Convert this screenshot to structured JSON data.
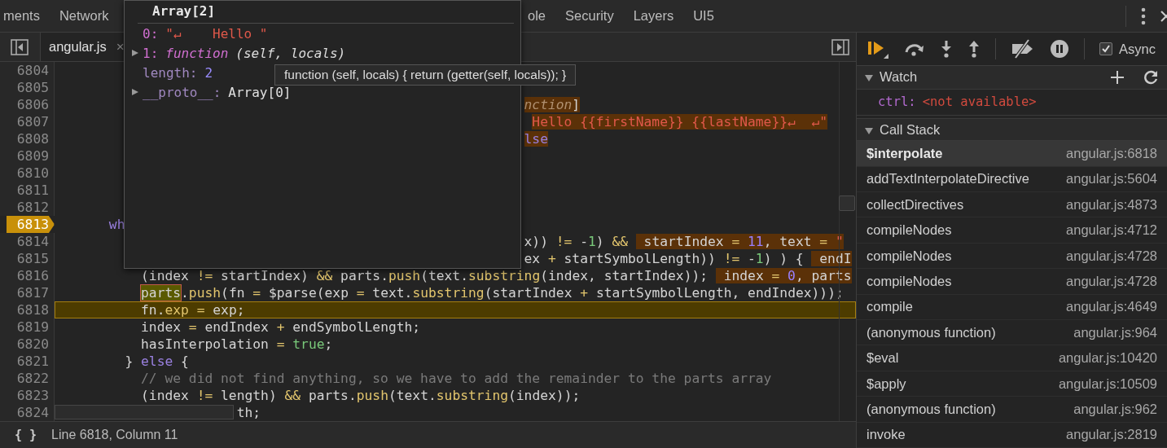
{
  "tab_groups": [
    [
      "ments",
      "Network"
    ],
    [
      "ole",
      "Security",
      "Layers",
      "UI5"
    ]
  ],
  "file_tab": {
    "label": "angular.js",
    "close": "×"
  },
  "popup": {
    "title": "Array[2]",
    "properties": [
      {
        "key": "0:",
        "value": "\"↵    Hello \"",
        "kind": "string",
        "expandable": false,
        "enumerable": true
      },
      {
        "key": "1:",
        "value": "function",
        "signature": "(self, locals)",
        "kind": "function",
        "expandable": true,
        "enumerable": true
      },
      {
        "key": "length:",
        "value": "2",
        "kind": "number",
        "expandable": false,
        "enumerable": false
      },
      {
        "key": "__proto__:",
        "value": "Array[0]",
        "kind": "object",
        "expandable": true,
        "enumerable": false
      }
    ]
  },
  "tooltip": "function (self, locals) { return (getter(self, locals)); }",
  "lines": [
    {
      "number": "6804",
      "breakpoint": false,
      "current": false
    },
    {
      "number": "6805",
      "breakpoint": false,
      "current": false
    },
    {
      "number": "6806",
      "breakpoint": false,
      "current": false,
      "inline_value": [
        {
          "text": "                                                          nction",
          "kind": "italic"
        },
        {
          "text": "]",
          "kind": "plain"
        }
      ]
    },
    {
      "number": "6807",
      "breakpoint": false,
      "current": false,
      "inline_value": [
        {
          "text": "                                                           Hello {{firstName}} {{lastName}}↵  ↵\"",
          "kind": "str"
        }
      ]
    },
    {
      "number": "6808",
      "breakpoint": false,
      "current": false,
      "inline_value": [
        {
          "text": "                                                          lse",
          "kind": "kw"
        }
      ]
    },
    {
      "number": "6809",
      "breakpoint": false,
      "current": false
    },
    {
      "number": "6810",
      "breakpoint": false,
      "current": false
    },
    {
      "number": "6811",
      "breakpoint": false,
      "current": false
    },
    {
      "number": "6812",
      "breakpoint": false,
      "current": false
    },
    {
      "number": "6813",
      "breakpoint": true,
      "current": false,
      "code": [
        {
          "text": "      wh",
          "kind": "kw"
        }
      ]
    },
    {
      "number": "6814",
      "breakpoint": false,
      "current": false,
      "code": [
        {
          "text": "                                                          x)) ",
          "kind": "plain"
        },
        {
          "text": "!=",
          "kind": "op"
        },
        {
          "text": " -",
          "kind": "plain"
        },
        {
          "text": "1",
          "kind": "num"
        },
        {
          "text": ") ",
          "kind": "plain"
        },
        {
          "text": "&& ",
          "kind": "op"
        }
      ],
      "inline_value": [
        {
          "text": " startIndex ",
          "kind": "plain"
        },
        {
          "text": "= ",
          "kind": "op"
        },
        {
          "text": "11",
          "kind": "num"
        },
        {
          "text": ", text ",
          "kind": "plain"
        },
        {
          "text": "=",
          "kind": "op"
        },
        {
          "text": " \"",
          "kind": "str"
        }
      ]
    },
    {
      "number": "6815",
      "breakpoint": false,
      "current": false,
      "code": [
        {
          "text": "                                                          ex ",
          "kind": "plain"
        },
        {
          "text": "+",
          "kind": "op"
        },
        {
          "text": " startSymbolLength)) ",
          "kind": "plain"
        },
        {
          "text": "!=",
          "kind": "op"
        },
        {
          "text": " -",
          "kind": "plain"
        },
        {
          "text": "1",
          "kind": "num"
        },
        {
          "text": ") ) { ",
          "kind": "plain"
        }
      ],
      "inline_value": [
        {
          "text": " endI",
          "kind": "plain"
        }
      ]
    },
    {
      "number": "6816",
      "breakpoint": false,
      "current": false,
      "code": [
        {
          "text": "          (index ",
          "kind": "plain"
        },
        {
          "text": "!=",
          "kind": "op"
        },
        {
          "text": " startIndex) ",
          "kind": "plain"
        },
        {
          "text": "&&",
          "kind": "op"
        },
        {
          "text": " parts.",
          "kind": "plain"
        },
        {
          "text": "push",
          "kind": "fn"
        },
        {
          "text": "(text.",
          "kind": "plain"
        },
        {
          "text": "substring",
          "kind": "fn"
        },
        {
          "text": "(index, startIndex)); ",
          "kind": "plain"
        }
      ],
      "inline_value": [
        {
          "text": " index ",
          "kind": "plain"
        },
        {
          "text": "= ",
          "kind": "op"
        },
        {
          "text": "0",
          "kind": "num"
        },
        {
          "text": ", parts",
          "kind": "plain"
        }
      ]
    },
    {
      "number": "6817",
      "breakpoint": false,
      "current": false,
      "code": [
        {
          "text": "          parts",
          "kind": "cur"
        },
        {
          "text": ".",
          "kind": "plain"
        },
        {
          "text": "push",
          "kind": "fn"
        },
        {
          "text": "(fn ",
          "kind": "plain"
        },
        {
          "text": "=",
          "kind": "op"
        },
        {
          "text": " $parse(exp ",
          "kind": "plain"
        },
        {
          "text": "=",
          "kind": "op"
        },
        {
          "text": " text.",
          "kind": "plain"
        },
        {
          "text": "substring",
          "kind": "fn"
        },
        {
          "text": "(startIndex ",
          "kind": "plain"
        },
        {
          "text": "+",
          "kind": "op"
        },
        {
          "text": " startSymbolLength, endIndex)));",
          "kind": "plain"
        }
      ]
    },
    {
      "number": "6818",
      "breakpoint": false,
      "current": true,
      "code": [
        {
          "text": "          fn.",
          "kind": "plain"
        },
        {
          "text": "exp",
          "kind": "fn"
        },
        {
          "text": " =",
          "kind": "op"
        },
        {
          "text": " exp;",
          "kind": "plain"
        }
      ]
    },
    {
      "number": "6819",
      "breakpoint": false,
      "current": false,
      "code": [
        {
          "text": "          index ",
          "kind": "plain"
        },
        {
          "text": "=",
          "kind": "op"
        },
        {
          "text": " endIndex ",
          "kind": "plain"
        },
        {
          "text": "+",
          "kind": "op"
        },
        {
          "text": " endSymbolLength;",
          "kind": "plain"
        }
      ]
    },
    {
      "number": "6820",
      "breakpoint": false,
      "current": false,
      "code": [
        {
          "text": "          hasInterpolation ",
          "kind": "plain"
        },
        {
          "text": "= ",
          "kind": "op"
        },
        {
          "text": "true",
          "kind": "bool"
        },
        {
          "text": ";",
          "kind": "plain"
        }
      ]
    },
    {
      "number": "6821",
      "breakpoint": false,
      "current": false,
      "code": [
        {
          "text": "        } ",
          "kind": "plain"
        },
        {
          "text": "else",
          "kind": "kw"
        },
        {
          "text": " {",
          "kind": "plain"
        }
      ]
    },
    {
      "number": "6822",
      "breakpoint": false,
      "current": false,
      "code": [
        {
          "text": "          // we did not find anything, so we have to add the remainder to the parts array",
          "kind": "comment"
        }
      ]
    },
    {
      "number": "6823",
      "breakpoint": false,
      "current": false,
      "code": [
        {
          "text": "          (index ",
          "kind": "plain"
        },
        {
          "text": "!=",
          "kind": "op"
        },
        {
          "text": " length) ",
          "kind": "plain"
        },
        {
          "text": "&&",
          "kind": "op"
        },
        {
          "text": " parts.",
          "kind": "plain"
        },
        {
          "text": "push",
          "kind": "fn"
        },
        {
          "text": "(text.",
          "kind": "plain"
        },
        {
          "text": "substring",
          "kind": "fn"
        },
        {
          "text": "(index));",
          "kind": "plain"
        }
      ]
    },
    {
      "number": "6824",
      "breakpoint": false,
      "current": false,
      "code": [
        {
          "text": "                      th;",
          "kind": "plain"
        }
      ]
    }
  ],
  "status_bar": {
    "format_button": "{ }",
    "position": "Line 6818, Column 11"
  },
  "debugger": {
    "async": {
      "label": "Async",
      "checked": true
    },
    "watch": {
      "title": "Watch",
      "expanded": true,
      "items": [
        {
          "name": "ctrl:",
          "value": "<not available>"
        }
      ]
    },
    "call_stack": {
      "title": "Call Stack",
      "expanded": true,
      "frames": [
        {
          "function": "$interpolate",
          "location": "angular.js:6818",
          "selected": true
        },
        {
          "function": "addTextInterpolateDirective",
          "location": "angular.js:5604",
          "selected": false
        },
        {
          "function": "collectDirectives",
          "location": "angular.js:4873",
          "selected": false
        },
        {
          "function": "compileNodes",
          "location": "angular.js:4712",
          "selected": false
        },
        {
          "function": "compileNodes",
          "location": "angular.js:4728",
          "selected": false
        },
        {
          "function": "compileNodes",
          "location": "angular.js:4728",
          "selected": false
        },
        {
          "function": "compile",
          "location": "angular.js:4649",
          "selected": false
        },
        {
          "function": "(anonymous function)",
          "location": "angular.js:964",
          "selected": false
        },
        {
          "function": "$eval",
          "location": "angular.js:10420",
          "selected": false
        },
        {
          "function": "$apply",
          "location": "angular.js:10509",
          "selected": false
        },
        {
          "function": "(anonymous function)",
          "location": "angular.js:962",
          "selected": false
        },
        {
          "function": "invoke",
          "location": "angular.js:2819",
          "selected": false
        }
      ]
    }
  }
}
